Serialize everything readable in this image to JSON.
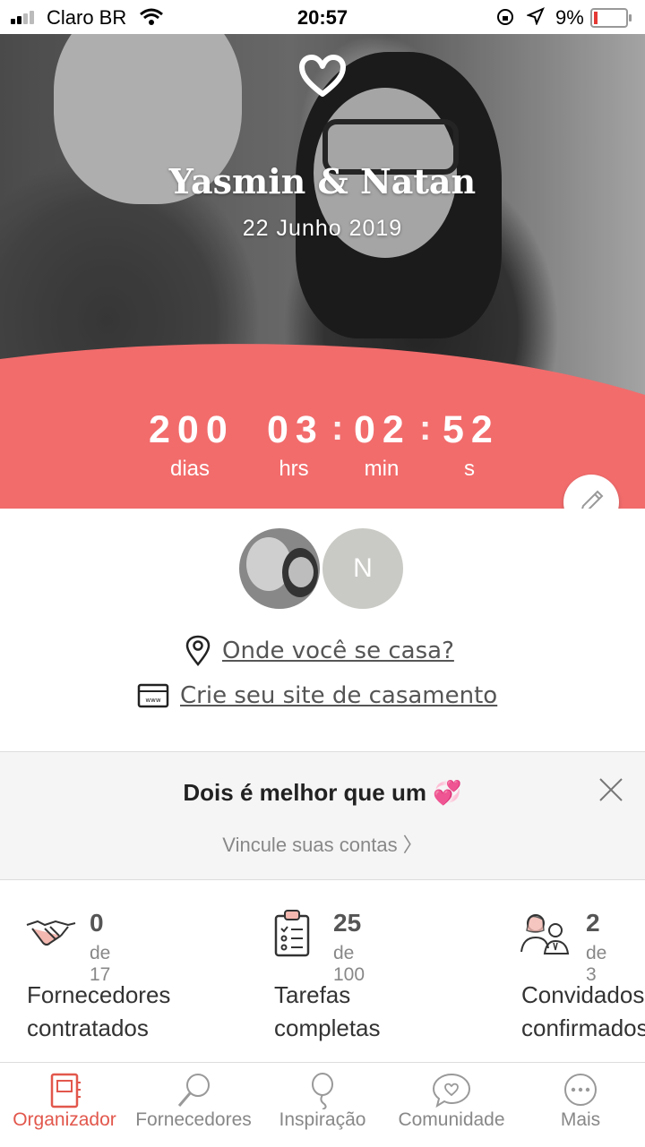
{
  "status_bar": {
    "carrier": "Claro BR",
    "time": "20:57",
    "battery": "9%"
  },
  "hero": {
    "couple_names": "Yasmin & Natan",
    "wedding_date": "22 Junho 2019",
    "countdown": {
      "days": "200",
      "hours": "03",
      "minutes": "02",
      "seconds": "52",
      "days_label": "dias",
      "hours_label": "hrs",
      "minutes_label": "min",
      "seconds_label": "s"
    },
    "accent_color": "#f26c6c"
  },
  "avatars": {
    "partner_initial": "N"
  },
  "links": {
    "venue": "Onde você se casa?",
    "website": "Crie seu site de casamento"
  },
  "banner": {
    "title": "Dois é melhor que um 💞",
    "subtitle": "Vincule suas contas 〉"
  },
  "stats": [
    {
      "value": "0",
      "of": "de 17",
      "label": "Fornecedores\ncontratados",
      "icon": "handshake-icon"
    },
    {
      "value": "25",
      "of": "de 100",
      "label": "Tarefas\ncompletas",
      "icon": "checklist-icon"
    },
    {
      "value": "2",
      "of": "de 3",
      "label": "Convidados\nconfirmados",
      "icon": "guests-icon"
    }
  ],
  "tabs": [
    {
      "label": "Organizador",
      "icon": "planner-icon",
      "active": true
    },
    {
      "label": "Fornecedores",
      "icon": "magnifier-icon"
    },
    {
      "label": "Inspiração",
      "icon": "balloon-icon"
    },
    {
      "label": "Comunidade",
      "icon": "chat-heart-icon"
    },
    {
      "label": "Mais",
      "icon": "more-icon"
    }
  ]
}
